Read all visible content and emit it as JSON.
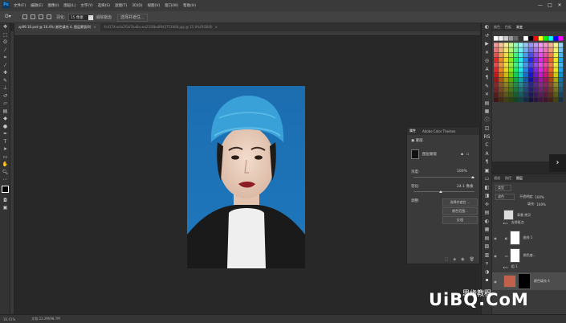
{
  "app": {
    "logo": "Ps"
  },
  "menu": [
    "文件(F)",
    "编辑(E)",
    "图像(I)",
    "图层(L)",
    "文字(Y)",
    "选择(S)",
    "滤镜(T)",
    "3D(D)",
    "视图(V)",
    "窗口(W)",
    "帮助(H)"
  ],
  "window_controls": [
    "—",
    "□",
    "✕"
  ],
  "options": {
    "feather_label": "羽化:",
    "feather_value": "15 像素",
    "antialias_label": "消除锯齿",
    "select_mask_label": "选择并遮住..."
  },
  "tabs": [
    {
      "label": "zp99.10.psd @ 16.4% (颜色填充 4, 图层蒙版/8)",
      "active": true,
      "close": "×"
    },
    {
      "label": "fc4174ca4a2f1b7ba8ccea2318ba8943751668.jpg @ 15.9%(RGB/8)",
      "active": false,
      "close": "×"
    }
  ],
  "toolbar_icons": [
    "move-icon",
    "marquee-icon",
    "lasso-icon",
    "quick-select-icon",
    "crop-icon",
    "eyedropper-icon",
    "healing-icon",
    "brush-icon",
    "stamp-icon",
    "history-brush-icon",
    "eraser-icon",
    "gradient-icon",
    "blur-icon",
    "dodge-icon",
    "pen-icon",
    "type-icon",
    "path-select-icon",
    "shape-icon",
    "hand-icon",
    "zoom-icon",
    "edit-toolbar-icon"
  ],
  "properties": {
    "tabs": [
      "属性",
      "Adobe Color Themes"
    ],
    "section_label": "蒙版",
    "mask_label": "图层蒙版",
    "density_label": "浓度:",
    "density_value": "100%",
    "feather_label": "羽化:",
    "feather_value": "24.1 像素",
    "refine_label": "调整:",
    "btn_select_mask": "选择并遮住 ...",
    "btn_color_range": "颜色范围...",
    "btn_invert": "反相"
  },
  "swatch_tabs": [
    "颜色",
    "色板",
    "渐变"
  ],
  "layers": {
    "tabs": [
      "图层",
      "通道",
      "路径"
    ],
    "kind_filter": "类型",
    "blend_mode": "滤色",
    "opacity_label": "不透明度:",
    "opacity_value": "100%",
    "fill_label": "填充:",
    "fill_value": "100%",
    "rows": [
      {
        "name": "背景 拷贝"
      },
      {
        "name": "去除斑点"
      },
      {
        "name": "曲线 1"
      },
      {
        "name": "颜色查..."
      },
      {
        "name": "组 1"
      },
      {
        "name": "颜色填充 4"
      }
    ]
  },
  "status": {
    "zoom": "16.41%",
    "doc": "文档:23.2M/98.7M"
  },
  "watermark": {
    "text": "UiBQ.CoM",
    "small": "思缘教程"
  },
  "colors": {
    "ui_bg": "#282828",
    "panel": "#3a3a3a",
    "photo_bg": "#1e6fb5"
  }
}
